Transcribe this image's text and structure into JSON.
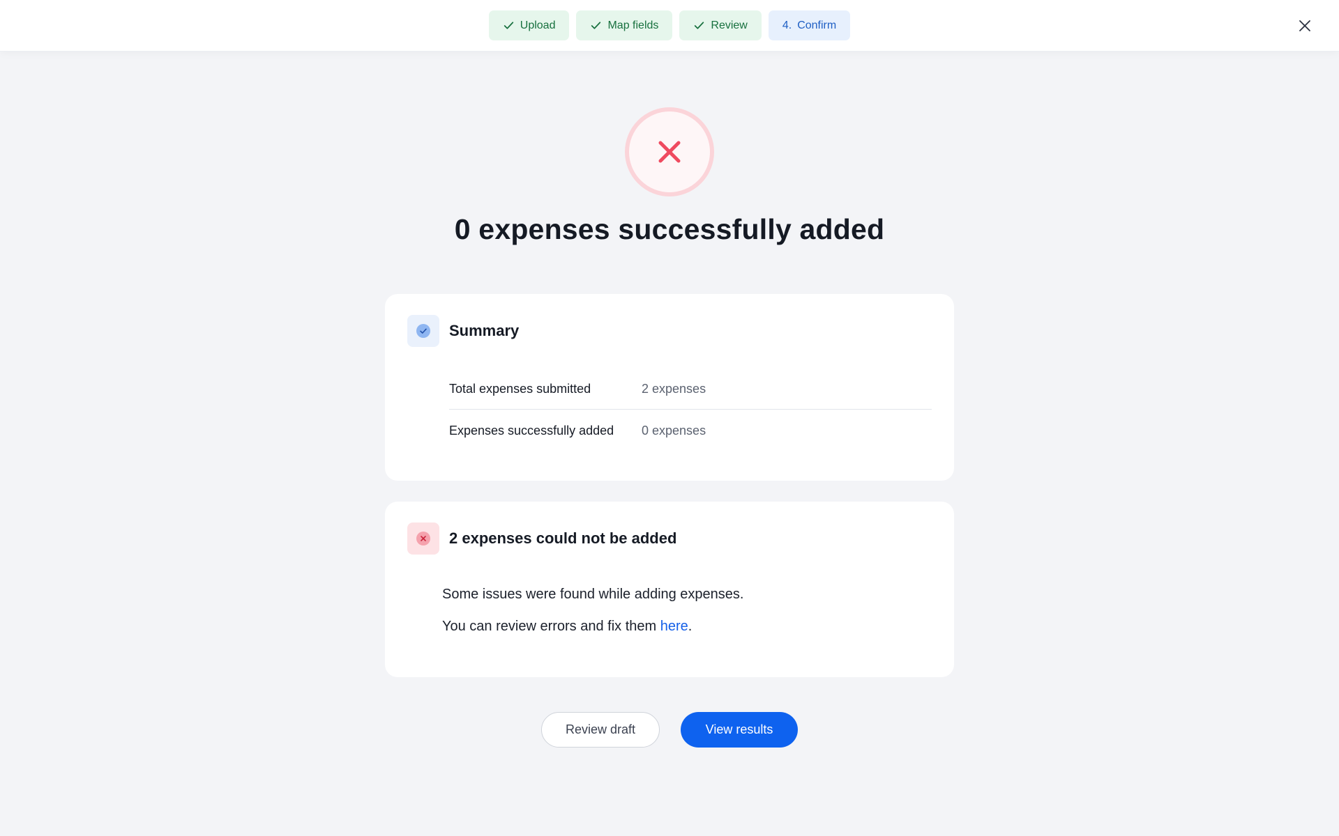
{
  "stepper": {
    "steps": [
      {
        "label": "Upload",
        "state": "done",
        "icon": "check-icon"
      },
      {
        "label": "Map fields",
        "state": "done",
        "icon": "check-icon"
      },
      {
        "label": "Review",
        "state": "done",
        "icon": "check-icon"
      },
      {
        "number": "4.",
        "label": "Confirm",
        "state": "current"
      }
    ]
  },
  "close_icon": "close-icon",
  "status": {
    "icon": "error-x-icon",
    "headline": "0 expenses successfully added"
  },
  "summary_card": {
    "icon": "check-circle-icon",
    "title": "Summary",
    "rows": [
      {
        "label": "Total expenses submitted",
        "value": "2 expenses"
      },
      {
        "label": "Expenses successfully added",
        "value": "0 expenses"
      }
    ]
  },
  "errors_card": {
    "icon": "error-circle-icon",
    "title": "2 expenses could not be added",
    "line1": "Some issues were found while adding expenses.",
    "line2_prefix": "You can review errors and fix them ",
    "line2_link": "here",
    "line2_suffix": "."
  },
  "actions": {
    "review_draft": "Review draft",
    "view_results": "View results"
  },
  "colors": {
    "accent": "#0e62ef",
    "success_bg": "#e6f6ec",
    "success_text": "#17703e",
    "error": "#ef4a5f",
    "current_step_bg": "#e7f0fd"
  }
}
